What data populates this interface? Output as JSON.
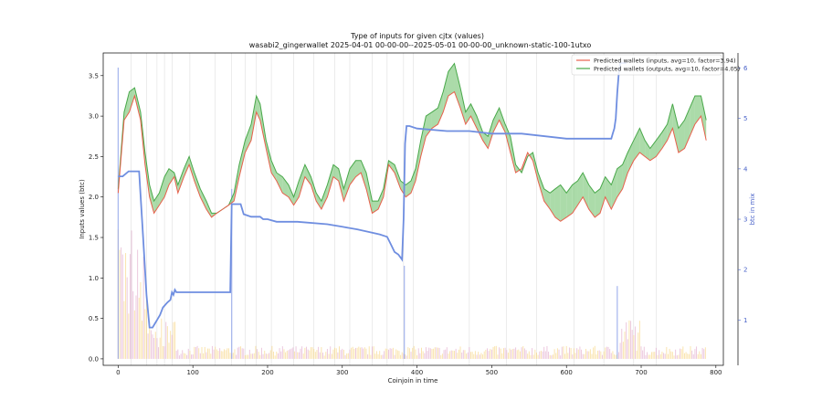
{
  "chart_data": {
    "type": "line",
    "title": "Type of inputs for given cjtx (values)",
    "subtitle": "wasabi2_gingerwallet 2025-04-01 00-00-00--2025-05-01 00-00-00_unknown-static-100-1utxo",
    "xlabel": "Coinjoin in time",
    "ylabel": "Inputs values (btc)",
    "ylabel_right": "btc in mix",
    "xlim": [
      -20,
      810
    ],
    "ylim": [
      -0.08,
      3.78
    ],
    "ylim_right": [
      0.1,
      6.3
    ],
    "x_ticks": [
      "0",
      "100",
      "200",
      "300",
      "400",
      "500",
      "600",
      "700",
      "800"
    ],
    "y_ticks": [
      "0.0",
      "0.5",
      "1.0",
      "1.5",
      "2.0",
      "2.5",
      "3.0",
      "3.5"
    ],
    "y_ticks_right": [
      "1",
      "2",
      "3",
      "4",
      "5",
      "6"
    ],
    "legend_position": "top-right",
    "legend": [
      {
        "label": "Predicted wallets (inputs, avg=10, factor=3.94)",
        "color": "#e8604c"
      },
      {
        "label": "Predicted wallets (outputs, avg=10, factor=4.05)",
        "color": "#49a84a"
      }
    ],
    "colors": {
      "inputs": "#e8604c",
      "outputs": "#49a84a",
      "fill_outputs_higher": "#8fcf8c",
      "fill_inputs_higher": "#f28c8c",
      "btc_in_mix": "#6f8ee0",
      "bars_inputs": "#f6d27a",
      "bars_outputs": "#e0a3c8"
    },
    "series": [
      {
        "name": "Predicted wallets (inputs, avg=10, factor=3.94)",
        "x": [
          0,
          8,
          15,
          22,
          30,
          36,
          42,
          48,
          55,
          62,
          68,
          75,
          80,
          88,
          95,
          102,
          110,
          118,
          125,
          132,
          140,
          148,
          155,
          162,
          170,
          178,
          185,
          190,
          198,
          205,
          212,
          220,
          228,
          235,
          242,
          250,
          258,
          265,
          272,
          280,
          288,
          295,
          302,
          310,
          318,
          325,
          332,
          340,
          348,
          355,
          362,
          370,
          378,
          385,
          392,
          398,
          405,
          412,
          420,
          428,
          435,
          442,
          450,
          458,
          465,
          472,
          480,
          488,
          495,
          502,
          510,
          518,
          525,
          532,
          540,
          548,
          555,
          562,
          570,
          578,
          585,
          592,
          600,
          608,
          615,
          622,
          630,
          638,
          645,
          652,
          660,
          668,
          675,
          682,
          690,
          698,
          705,
          712,
          720,
          728,
          735,
          742,
          750,
          758,
          765,
          772,
          780,
          787
        ],
        "values": [
          2.05,
          2.95,
          3.05,
          3.25,
          2.95,
          2.4,
          2.0,
          1.8,
          1.9,
          2.0,
          2.15,
          2.25,
          2.05,
          2.25,
          2.4,
          2.2,
          2.0,
          1.85,
          1.75,
          1.8,
          1.85,
          1.9,
          1.95,
          2.25,
          2.55,
          2.7,
          3.05,
          2.95,
          2.6,
          2.3,
          2.2,
          2.05,
          2.0,
          1.9,
          2.0,
          2.25,
          2.15,
          1.95,
          1.85,
          2.0,
          2.25,
          2.2,
          1.95,
          2.15,
          2.25,
          2.3,
          2.1,
          1.8,
          1.85,
          2.0,
          2.4,
          2.3,
          2.1,
          2.0,
          2.05,
          2.2,
          2.5,
          2.75,
          2.85,
          2.9,
          3.05,
          3.25,
          3.3,
          3.1,
          2.9,
          3.0,
          2.85,
          2.7,
          2.6,
          2.8,
          2.95,
          2.8,
          2.55,
          2.3,
          2.35,
          2.55,
          2.45,
          2.2,
          1.95,
          1.85,
          1.75,
          1.7,
          1.75,
          1.8,
          1.9,
          2.0,
          1.85,
          1.75,
          1.8,
          2.0,
          1.85,
          2.0,
          2.1,
          2.3,
          2.45,
          2.55,
          2.5,
          2.45,
          2.5,
          2.6,
          2.7,
          2.85,
          2.55,
          2.6,
          2.75,
          2.9,
          3.0,
          2.7
        ]
      },
      {
        "name": "Predicted wallets (outputs, avg=10, factor=4.05)",
        "x": [
          0,
          8,
          15,
          22,
          30,
          36,
          42,
          48,
          55,
          62,
          68,
          75,
          80,
          88,
          95,
          102,
          110,
          118,
          125,
          132,
          140,
          148,
          155,
          162,
          170,
          178,
          185,
          190,
          198,
          205,
          212,
          220,
          228,
          235,
          242,
          250,
          258,
          265,
          272,
          280,
          288,
          295,
          302,
          310,
          318,
          325,
          332,
          340,
          348,
          355,
          362,
          370,
          378,
          385,
          392,
          398,
          405,
          412,
          420,
          428,
          435,
          442,
          450,
          458,
          465,
          472,
          480,
          488,
          495,
          502,
          510,
          518,
          525,
          532,
          540,
          548,
          555,
          562,
          570,
          578,
          585,
          592,
          600,
          608,
          615,
          622,
          630,
          638,
          645,
          652,
          660,
          668,
          675,
          682,
          690,
          698,
          705,
          712,
          720,
          728,
          735,
          742,
          750,
          758,
          765,
          772,
          780,
          787
        ],
        "values": [
          2.1,
          3.05,
          3.3,
          3.35,
          3.05,
          2.55,
          2.15,
          1.95,
          2.05,
          2.25,
          2.35,
          2.3,
          2.15,
          2.35,
          2.5,
          2.3,
          2.1,
          1.95,
          1.8,
          1.8,
          1.85,
          1.9,
          2.05,
          2.4,
          2.7,
          2.9,
          3.25,
          3.15,
          2.7,
          2.45,
          2.3,
          2.25,
          2.15,
          2.0,
          2.2,
          2.4,
          2.25,
          2.05,
          1.95,
          2.15,
          2.4,
          2.35,
          2.1,
          2.35,
          2.45,
          2.45,
          2.3,
          1.95,
          1.95,
          2.1,
          2.45,
          2.4,
          2.2,
          2.15,
          2.2,
          2.35,
          2.7,
          3.0,
          3.05,
          3.1,
          3.3,
          3.55,
          3.65,
          3.35,
          3.05,
          3.15,
          3.0,
          2.8,
          2.75,
          2.95,
          3.1,
          2.9,
          2.75,
          2.4,
          2.3,
          2.5,
          2.55,
          2.3,
          2.1,
          2.05,
          2.1,
          2.15,
          2.05,
          2.15,
          2.2,
          2.3,
          2.15,
          2.05,
          2.1,
          2.25,
          2.15,
          2.35,
          2.4,
          2.55,
          2.7,
          2.85,
          2.7,
          2.6,
          2.7,
          2.8,
          2.9,
          3.15,
          2.85,
          2.95,
          3.1,
          3.25,
          3.25,
          2.95
        ]
      },
      {
        "name": "btc in mix",
        "axis": "right",
        "x": [
          0,
          3,
          6,
          14,
          16,
          18,
          24,
          26,
          28,
          32,
          36,
          38,
          42,
          44,
          46,
          50,
          52,
          56,
          60,
          66,
          70,
          72,
          74,
          76,
          78,
          80,
          150,
          152,
          154,
          164,
          168,
          178,
          186,
          190,
          194,
          200,
          212,
          240,
          280,
          300,
          320,
          350,
          360,
          365,
          370,
          375,
          380,
          382,
          384,
          386,
          388,
          390,
          400,
          440,
          470,
          500,
          540,
          600,
          660,
          662,
          664,
          666,
          668,
          670,
          672,
          675,
          677,
          680
        ],
        "values": [
          3.85,
          3.85,
          3.85,
          3.95,
          3.95,
          3.95,
          3.95,
          3.95,
          3.95,
          3.0,
          2.0,
          1.5,
          0.85,
          0.85,
          0.85,
          0.95,
          1.0,
          1.1,
          1.25,
          1.35,
          1.4,
          1.55,
          1.5,
          1.6,
          1.55,
          1.55,
          1.55,
          3.3,
          3.3,
          3.3,
          3.1,
          3.05,
          3.05,
          3.05,
          3.0,
          3.0,
          2.95,
          2.95,
          2.9,
          2.85,
          2.8,
          2.7,
          2.65,
          2.5,
          2.35,
          2.3,
          2.2,
          3.0,
          4.5,
          4.85,
          4.85,
          4.85,
          4.8,
          4.75,
          4.75,
          4.7,
          4.7,
          4.6,
          4.6,
          4.7,
          4.8,
          5.0,
          5.5,
          5.9,
          6.1,
          6.1,
          6.1,
          6.1
        ]
      }
    ]
  }
}
